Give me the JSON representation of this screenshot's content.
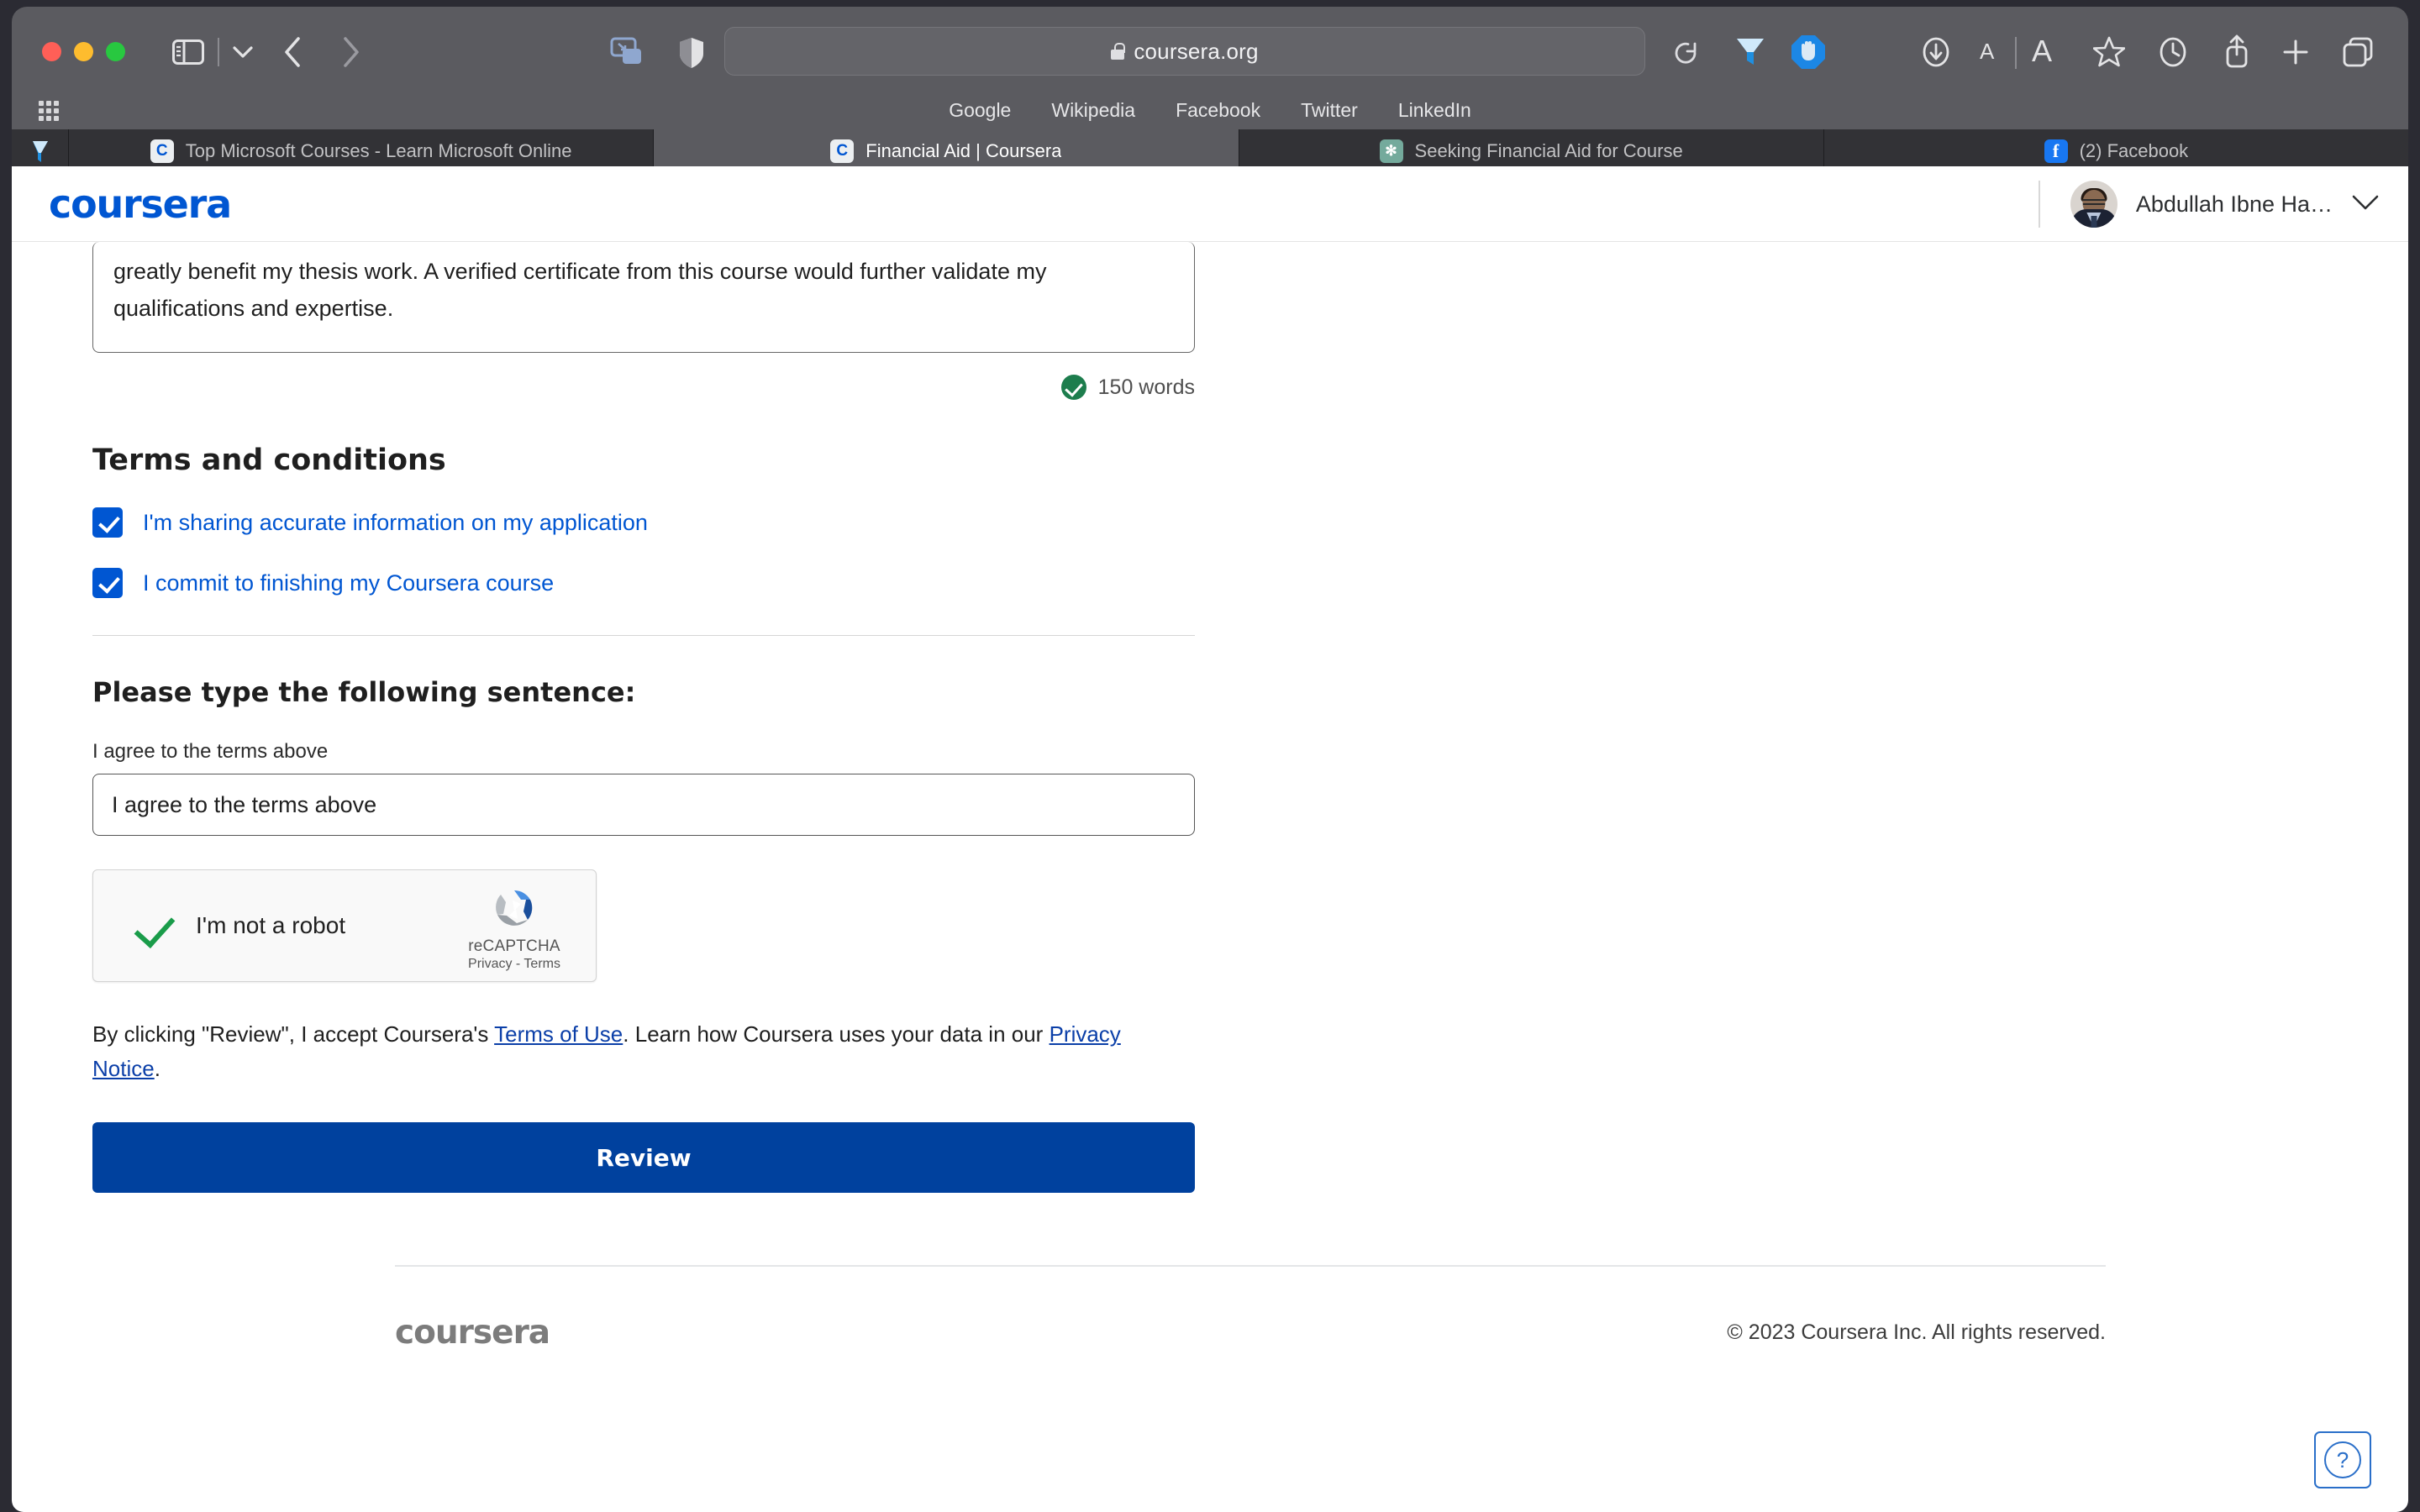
{
  "browser": {
    "url": "coursera.org",
    "window_controls": [
      "close",
      "minimize",
      "maximize"
    ],
    "toolbar_icons": [
      "sidebar-toggle-icon",
      "chevron-down-icon",
      "back-arrow-icon",
      "forward-arrow-icon",
      "tab-overview-icon",
      "shield-icon",
      "reader-view-icon",
      "reload-icon",
      "funnel-extension-icon",
      "adblock-extension-icon",
      "downloads-icon",
      "font-smaller-icon",
      "font-larger-icon",
      "bookmark-star-icon",
      "history-clock-icon",
      "share-icon",
      "new-tab-icon",
      "tab-group-icon"
    ],
    "bookmarks": [
      {
        "label": "Google"
      },
      {
        "label": "Wikipedia"
      },
      {
        "label": "Facebook"
      },
      {
        "label": "Twitter"
      },
      {
        "label": "LinkedIn"
      }
    ],
    "tabs": [
      {
        "title": "Top Microsoft Courses - Learn Microsoft Online",
        "favicon": "coursera",
        "favicon_letter": "C",
        "active": false
      },
      {
        "title": "Financial Aid | Coursera",
        "favicon": "coursera",
        "favicon_letter": "C",
        "active": true
      },
      {
        "title": "Seeking Financial Aid for Course",
        "favicon": "openai",
        "favicon_letter": "✻",
        "active": false
      },
      {
        "title": "(2) Facebook",
        "favicon": "facebook",
        "favicon_letter": "f",
        "active": false
      }
    ]
  },
  "site_header": {
    "logo_text": "coursera",
    "user_name": "Abdullah Ibne Ha…",
    "chevron": "chevron-down-icon",
    "brand_color": "#0056d2"
  },
  "form": {
    "essay_text": "greatly benefit my thesis work. A verified certificate from this course would further validate my qualifications and expertise.",
    "word_count": "150 words",
    "terms_title": "Terms and conditions",
    "checkboxes": [
      {
        "label": "I'm sharing accurate information on my application",
        "checked": true
      },
      {
        "label": "I commit to finishing my Coursera course",
        "checked": true
      }
    ],
    "type_sentence_title": "Please type the following sentence:",
    "sentence_label": "I agree to the terms above",
    "sentence_value": "I agree to the terms above",
    "sentence_placeholder": "I agree to the terms above",
    "recaptcha": {
      "label": "I'm not a robot",
      "checked": true,
      "brand": "reCAPTCHA",
      "links": "Privacy - Terms"
    },
    "legal_prefix": "By clicking \"Review\", I accept Coursera's ",
    "legal_link_terms": "Terms of Use",
    "legal_middle": ". Learn how Coursera uses your data in our ",
    "legal_link_privacy": "Privacy Notice",
    "legal_suffix": ".",
    "submit_label": "Review",
    "submit_color": "#00419e"
  },
  "footer": {
    "logo_text": "coursera",
    "copyright": "© 2023 Coursera Inc. All rights reserved.",
    "help_label": "?"
  }
}
